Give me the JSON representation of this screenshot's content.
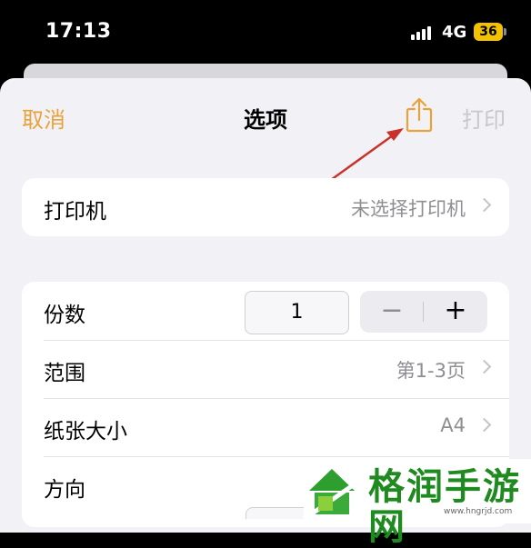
{
  "status_bar": {
    "time": "17:13",
    "network": "4G",
    "battery": "36"
  },
  "nav": {
    "cancel": "取消",
    "title": "选项",
    "print": "打印"
  },
  "printer": {
    "label": "打印机",
    "value": "未选择打印机"
  },
  "options": {
    "copies": {
      "label": "份数",
      "value": "1",
      "minus": "−",
      "plus": "+"
    },
    "range": {
      "label": "范围",
      "value": "第1-3页"
    },
    "paper_size": {
      "label": "纸张大小",
      "value": "A4"
    },
    "orientation": {
      "label": "方向"
    }
  },
  "watermark": {
    "text": "格润手游网",
    "url": "www.hngrjd.com"
  },
  "colors": {
    "accent": "#e8a23a",
    "disabled": "#c7c7cc",
    "annotation_arrow": "#c8322c",
    "watermark": "#1f8a1f"
  }
}
